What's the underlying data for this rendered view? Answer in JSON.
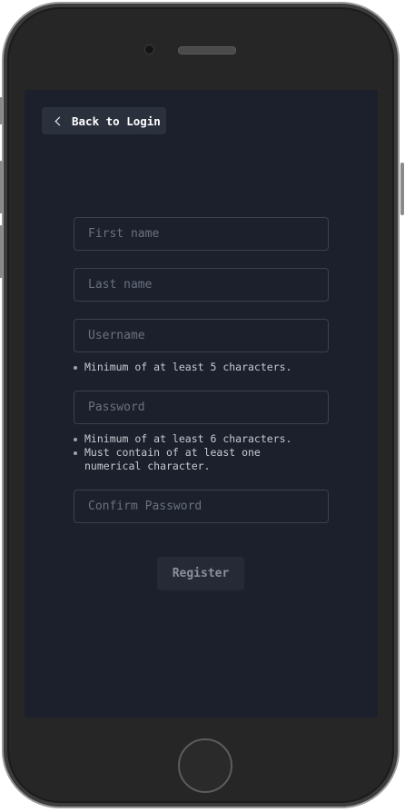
{
  "back_button": {
    "label": "Back to Login",
    "icon": "chevron-left-icon"
  },
  "form": {
    "first_name": {
      "placeholder": "First name",
      "value": ""
    },
    "last_name": {
      "placeholder": "Last name",
      "value": ""
    },
    "username": {
      "placeholder": "Username",
      "value": "",
      "hints": [
        "Minimum of at least 5 characters."
      ]
    },
    "password": {
      "placeholder": "Password",
      "value": "",
      "hints": [
        "Minimum of at least 6 characters.",
        "Must contain of at least one numerical character."
      ]
    },
    "confirm_password": {
      "placeholder": "Confirm Password",
      "value": ""
    },
    "register_label": "Register"
  },
  "colors": {
    "screen_background": "#1b202c",
    "button_background": "#2b303d",
    "field_border": "#3a4150"
  }
}
